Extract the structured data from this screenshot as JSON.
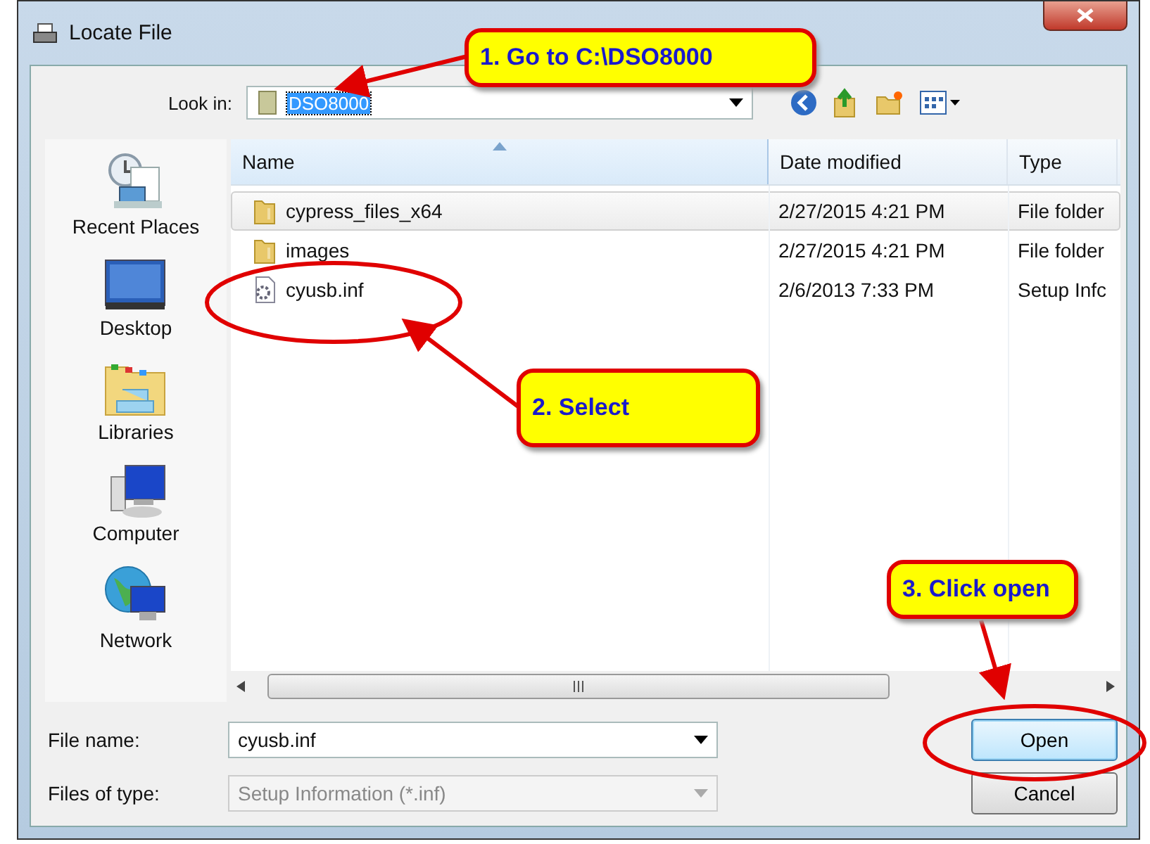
{
  "window": {
    "title": "Locate File"
  },
  "look_in": {
    "label": "Look in:",
    "value": "DSO8000"
  },
  "places": [
    {
      "label": "Recent Places",
      "kind": "recent"
    },
    {
      "label": "Desktop",
      "kind": "desktop"
    },
    {
      "label": "Libraries",
      "kind": "libraries"
    },
    {
      "label": "Computer",
      "kind": "computer"
    },
    {
      "label": "Network",
      "kind": "network"
    }
  ],
  "file_list": {
    "columns": [
      "Name",
      "Date modified",
      "Type"
    ],
    "rows": [
      {
        "name": "cypress_files_x64",
        "date": "2/27/2015 4:21 PM",
        "type": "File folder",
        "kind": "folder",
        "selected": true
      },
      {
        "name": "images",
        "date": "2/27/2015 4:21 PM",
        "type": "File folder",
        "kind": "folder",
        "selected": false
      },
      {
        "name": "cyusb.inf",
        "date": "2/6/2013 7:33 PM",
        "type": "Setup Infc",
        "kind": "setup",
        "selected": false
      }
    ]
  },
  "file_name": {
    "label": "File name:",
    "value": "cyusb.inf"
  },
  "file_type": {
    "label": "Files of type:",
    "value": "Setup Information (*.inf)",
    "disabled": true
  },
  "buttons": [
    {
      "label": "Open",
      "focused": true
    },
    {
      "label": "Cancel",
      "focused": false
    }
  ],
  "annotations": [
    {
      "text": "1. Go to C:\\DSO8000"
    },
    {
      "text": "2. Select"
    },
    {
      "text": "3. Click open"
    }
  ]
}
